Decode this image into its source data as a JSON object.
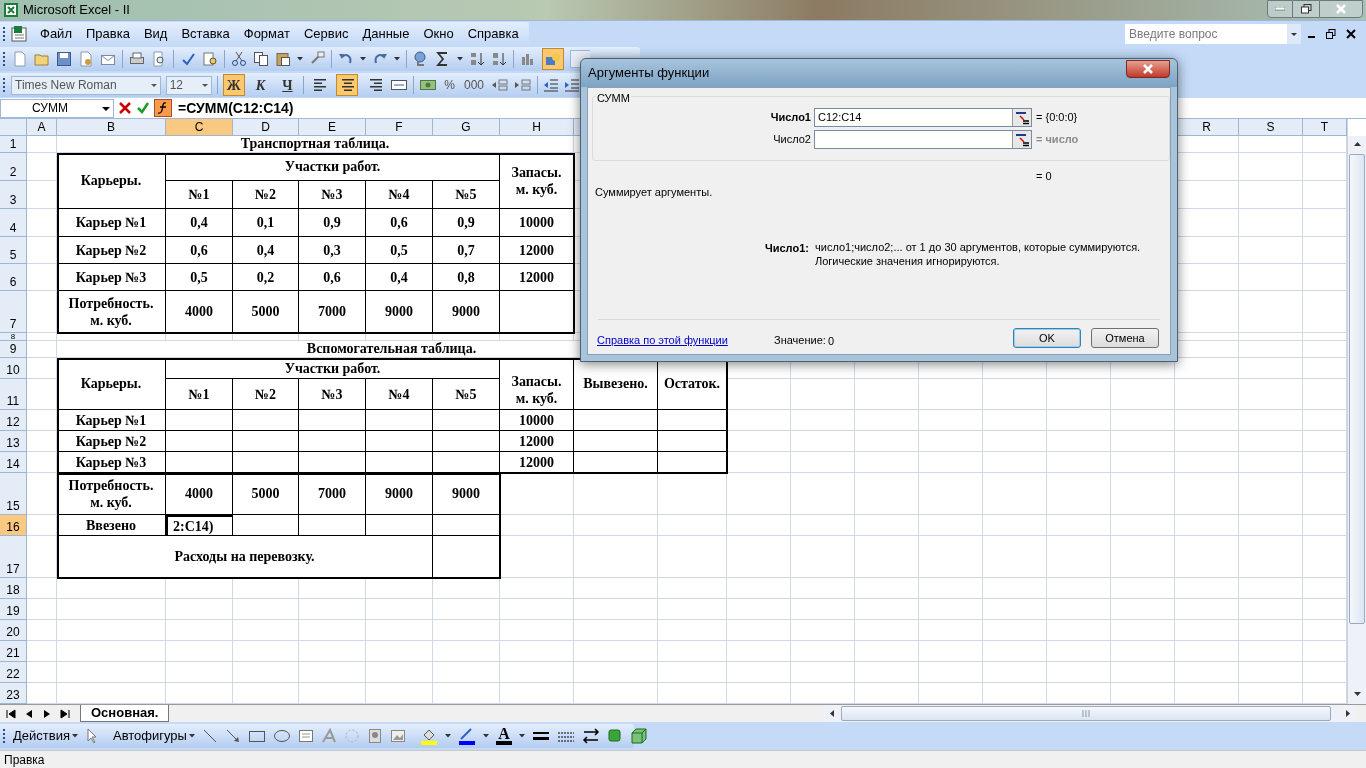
{
  "window": {
    "title": "Microsoft Excel - II"
  },
  "menu": [
    "Файл",
    "Правка",
    "Вид",
    "Вставка",
    "Формат",
    "Сервис",
    "Данные",
    "Окно",
    "Справка"
  ],
  "help_box": {
    "placeholder": "Введите вопрос"
  },
  "standard_toolbar": {
    "drawing_selected": true
  },
  "formatting": {
    "font": "Times New Roman",
    "size": "12",
    "buttons": [
      {
        "label": "Ж",
        "selected": true
      },
      {
        "label": "К",
        "selected": false
      },
      {
        "label": "Ч",
        "selected": false
      }
    ],
    "alignment": [
      {
        "kind": "left",
        "selected": false
      },
      {
        "kind": "center",
        "selected": true
      },
      {
        "kind": "right",
        "selected": false
      }
    ],
    "number_buttons": [
      "%",
      "000"
    ]
  },
  "formula_bar": {
    "name_box": "СУММ",
    "fx_selected": true,
    "formula": "=СУММ(C12:C14)"
  },
  "column_headers": [
    {
      "label": "A",
      "selected": false
    },
    {
      "label": "B",
      "selected": false
    },
    {
      "label": "C",
      "selected": true
    },
    {
      "label": "D",
      "selected": false
    },
    {
      "label": "E",
      "selected": false
    },
    {
      "label": "F",
      "selected": false
    },
    {
      "label": "G",
      "selected": false
    },
    {
      "label": "H",
      "selected": false
    },
    {
      "label": "R",
      "selected": false
    },
    {
      "label": "S",
      "selected": false
    },
    {
      "label": "T",
      "selected": false
    }
  ],
  "row_headers": [
    {
      "label": "1",
      "selected": false
    },
    {
      "label": "2",
      "selected": false
    },
    {
      "label": "3",
      "selected": false
    },
    {
      "label": "4",
      "selected": false
    },
    {
      "label": "5",
      "selected": false
    },
    {
      "label": "6",
      "selected": false
    },
    {
      "label": "7",
      "selected": false
    },
    {
      "label": "8",
      "selected": false
    },
    {
      "label": "9",
      "selected": false
    },
    {
      "label": "10",
      "selected": false
    },
    {
      "label": "11",
      "selected": false
    },
    {
      "label": "12",
      "selected": false
    },
    {
      "label": "13",
      "selected": false
    },
    {
      "label": "14",
      "selected": false
    },
    {
      "label": "15",
      "selected": false
    },
    {
      "label": "16",
      "selected": true
    },
    {
      "label": "17",
      "selected": false
    },
    {
      "label": "18",
      "selected": false
    },
    {
      "label": "19",
      "selected": false
    },
    {
      "label": "20",
      "selected": false
    },
    {
      "label": "21",
      "selected": false
    },
    {
      "label": "22",
      "selected": false
    },
    {
      "label": "23",
      "selected": false
    }
  ],
  "transport_table": {
    "title": "Транспортная таблица.",
    "corner": "Карьеры.",
    "group": "Участки работ.",
    "columns": [
      "№1",
      "№2",
      "№3",
      "№4",
      "№5"
    ],
    "stock_header": "Запасы. м. куб.",
    "rows": [
      {
        "name": "Карьер №1",
        "values": [
          "0,4",
          "0,1",
          "0,9",
          "0,6",
          "0,9"
        ],
        "stock": "10000"
      },
      {
        "name": "Карьер №2",
        "values": [
          "0,6",
          "0,4",
          "0,3",
          "0,5",
          "0,7"
        ],
        "stock": "12000"
      },
      {
        "name": "Карьер №3",
        "values": [
          "0,5",
          "0,2",
          "0,6",
          "0,4",
          "0,8"
        ],
        "stock": "12000"
      }
    ],
    "demand": {
      "label": "Потребность. м. куб.",
      "values": [
        "4000",
        "5000",
        "7000",
        "9000",
        "9000"
      ]
    }
  },
  "aux_table": {
    "title": "Вспомогательная таблица.",
    "corner": "Карьеры.",
    "group": "Участки работ.",
    "columns": [
      "№1",
      "№2",
      "№3",
      "№4",
      "№5"
    ],
    "stock_header": "Запасы. м. куб.",
    "shipped_header": "Вывезено.",
    "remainder_header": "Остаток.",
    "rows": [
      {
        "name": "Карьер №1",
        "stock": "10000"
      },
      {
        "name": "Карьер №2",
        "stock": "12000"
      },
      {
        "name": "Карьер №3",
        "stock": "12000"
      }
    ],
    "demand": {
      "label": "Потребность. м. куб.",
      "values": [
        "4000",
        "5000",
        "7000",
        "9000",
        "9000"
      ]
    },
    "received": {
      "label": "Ввезено",
      "value": "2:C14)",
      "selected": true
    },
    "cost_label": "Расходы на перевозку."
  },
  "sheet_tabs": [
    {
      "label": "Основная.",
      "selected": true
    }
  ],
  "drawing_toolbar": {
    "actions": "Действия",
    "autoshapes": "Автофигуры",
    "font_color": "A"
  },
  "status_bar": "Правка",
  "dialog": {
    "title": "Аргументы функции",
    "function": "СУММ",
    "arguments": [
      {
        "label": "Число1",
        "active": true,
        "value": "C12:C14",
        "result": "= {0:0:0}"
      },
      {
        "label": "Число2",
        "active": false,
        "result": "= число"
      }
    ],
    "total": "= 0",
    "description": "Суммирует аргументы.",
    "arg_label": "Число1:",
    "arg_help": "число1;число2;... от 1 до 30 аргументов, которые суммируются. Логические значения игнорируются.",
    "help_link": "Справка по этой функции",
    "value_label": "Значение:",
    "value": "0",
    "buttons": [
      {
        "label": "OK",
        "focused": true
      },
      {
        "label": "Отмена",
        "focused": false
      }
    ]
  }
}
